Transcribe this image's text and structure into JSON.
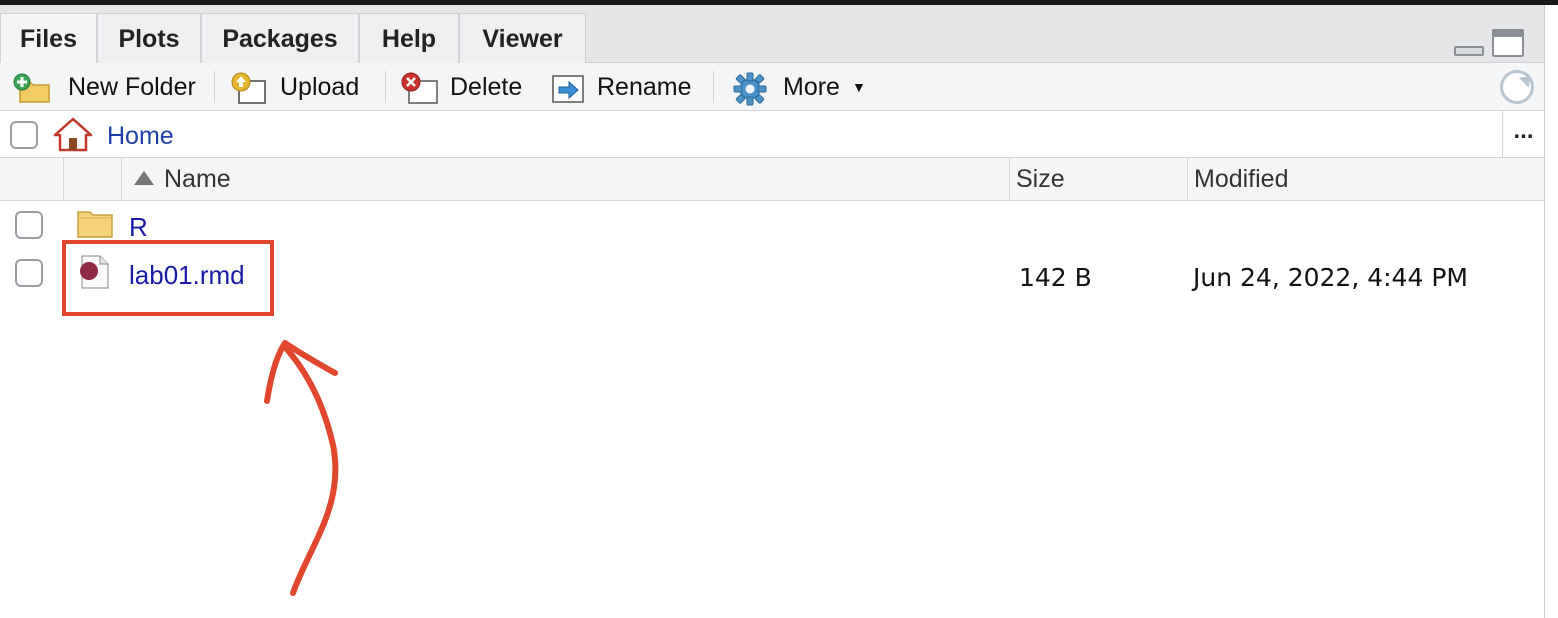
{
  "tabs": [
    {
      "label": "Files",
      "active": true
    },
    {
      "label": "Plots",
      "active": false
    },
    {
      "label": "Packages",
      "active": false
    },
    {
      "label": "Help",
      "active": false
    },
    {
      "label": "Viewer",
      "active": false
    }
  ],
  "toolbar": {
    "new_folder": "New Folder",
    "upload": "Upload",
    "delete": "Delete",
    "rename": "Rename",
    "more": "More"
  },
  "breadcrumb": {
    "home": "Home",
    "overflow": "..."
  },
  "columns": {
    "name": "Name",
    "size": "Size",
    "modified": "Modified"
  },
  "files": [
    {
      "name": "R",
      "type": "folder",
      "size": "",
      "modified": ""
    },
    {
      "name": "lab01.rmd",
      "type": "rmd",
      "size": "142 B",
      "modified": "Jun 24, 2022, 4:44 PM"
    }
  ],
  "annotation": {
    "color": "#e0472c",
    "highlighted_item": "lab01.rmd"
  },
  "colors": {
    "link": "#1a1aa8",
    "tab_bg": "#e5e6e8",
    "accent_red": "#e0472c"
  }
}
